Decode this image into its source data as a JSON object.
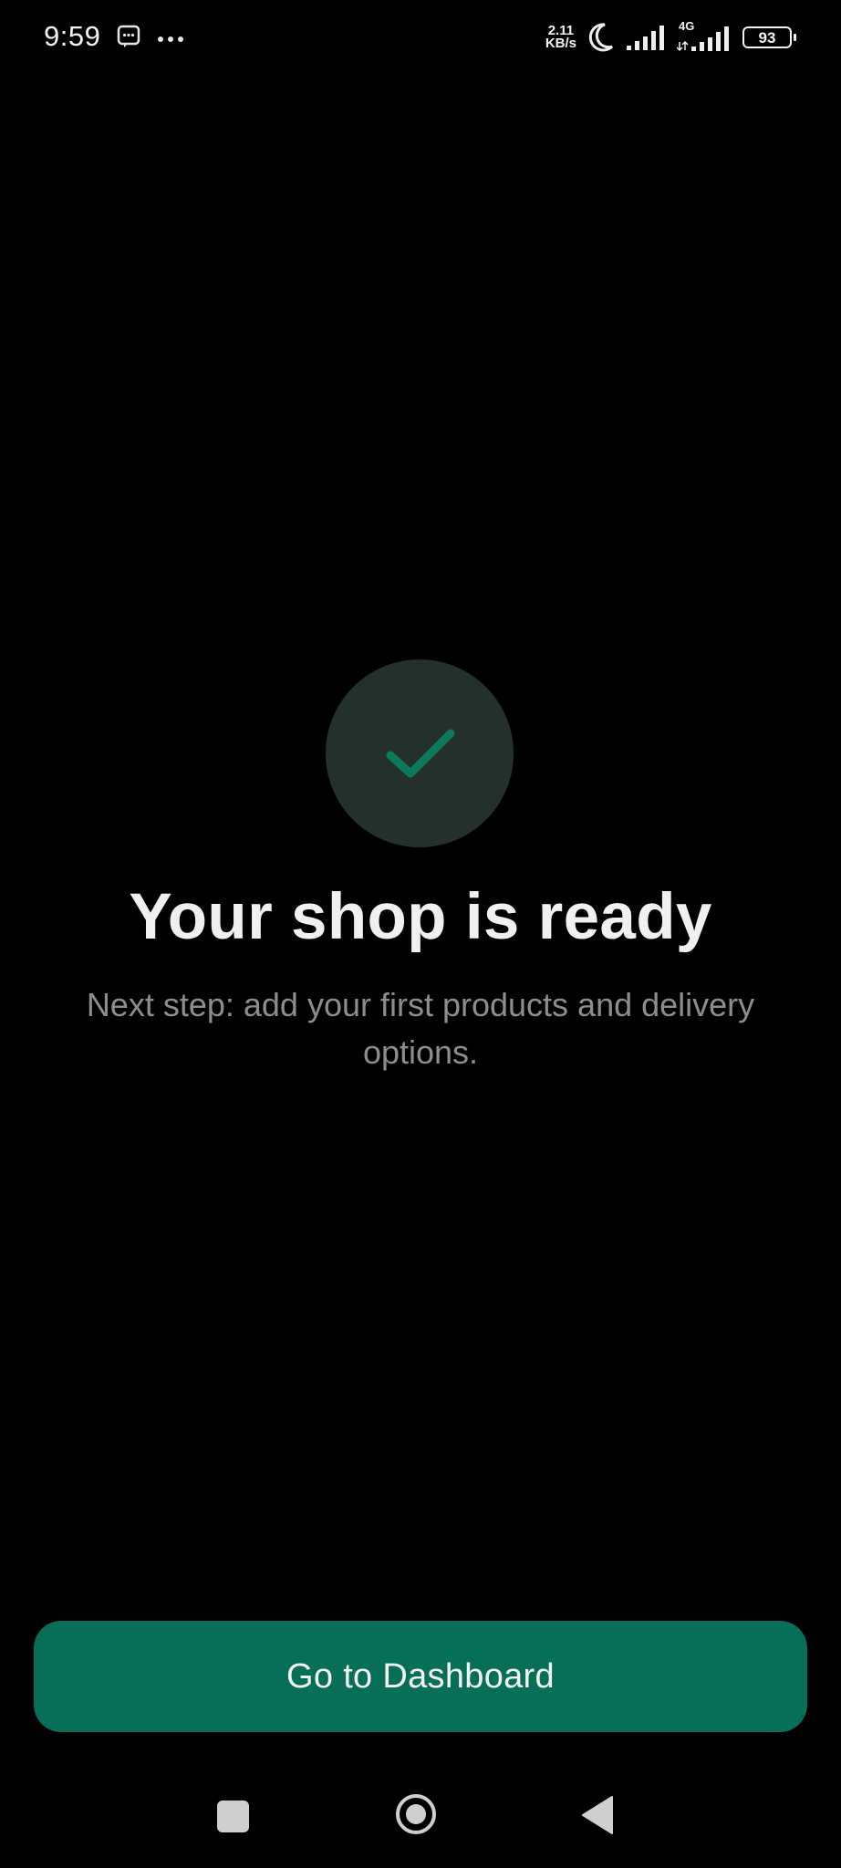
{
  "status_bar": {
    "time": "9:59",
    "net_speed_value": "2.11",
    "net_speed_unit": "KB/s",
    "network_type": "4G",
    "battery_level": "93",
    "icons": [
      "message-icon",
      "more-dots-icon",
      "moon-icon",
      "signal-icon",
      "signal-4g-icon",
      "battery-icon"
    ]
  },
  "main": {
    "status_icon": "check-icon",
    "title": "Your shop is ready",
    "subtitle": "Next step: add your first products and delivery options."
  },
  "actions": {
    "primary_label": "Go to Dashboard"
  },
  "nav_bar": {
    "icons": [
      "recent-apps-icon",
      "home-icon",
      "back-icon"
    ]
  },
  "colors": {
    "background": "#000000",
    "accent": "#076f58",
    "check": "#0b7a5c",
    "circle": "#24302c",
    "subtitle_text": "#8d8d8d"
  }
}
